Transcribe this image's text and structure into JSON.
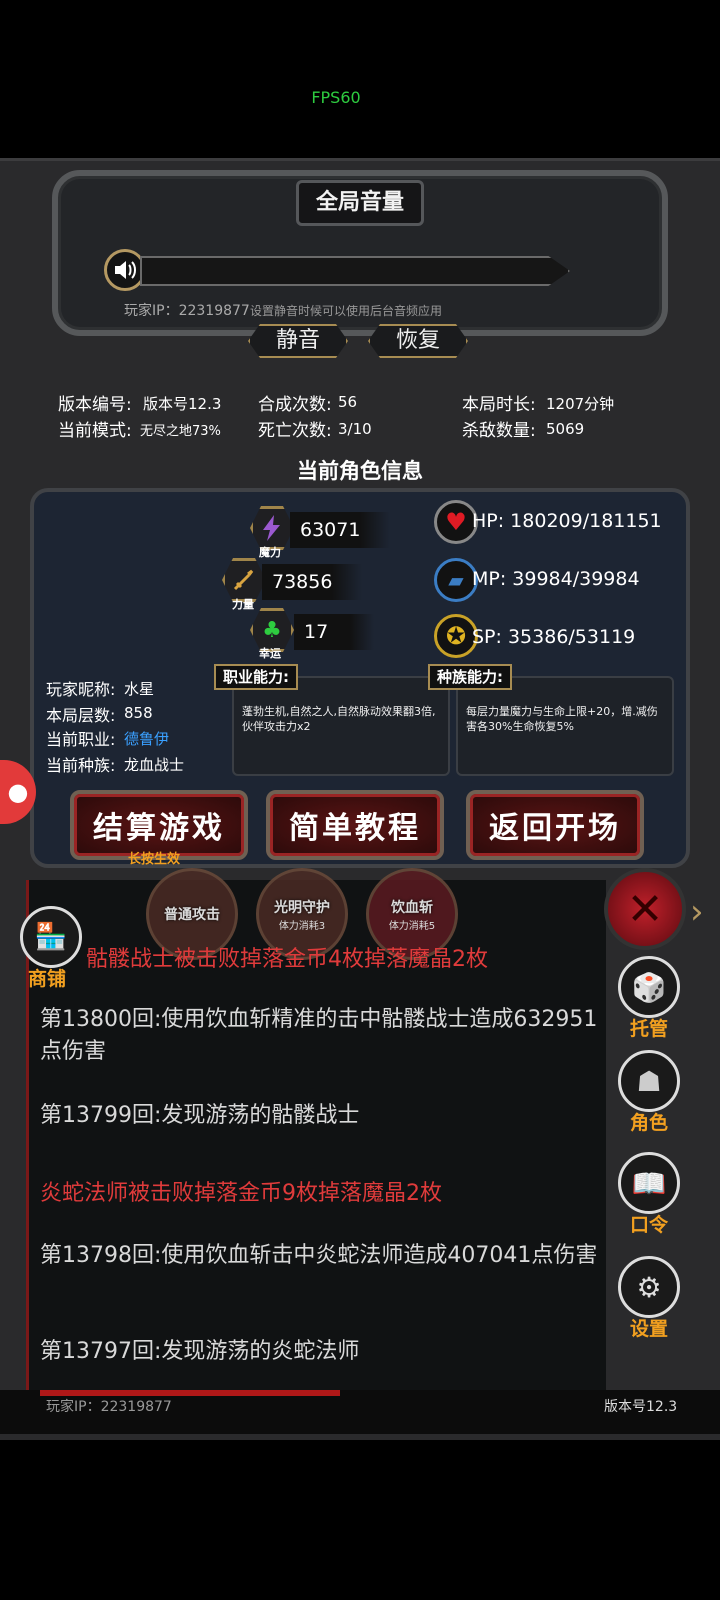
{
  "fps": "FPS60",
  "volume_panel": {
    "title": "全局音量",
    "player_ip": "玩家IP：22319877",
    "hint": "设置静音时候可以使用后台音频应用",
    "mute_label": "静音",
    "restore_label": "恢复"
  },
  "stats": {
    "version_label": "版本编号:",
    "version_value": "版本号12.3",
    "mode_label": "当前模式:",
    "mode_value": "无尽之地73%",
    "merge_label": "合成次数:",
    "merge_value": "56",
    "death_label": "死亡次数:",
    "death_value": "3/10",
    "time_label": "本局时长:",
    "time_value": "1207分钟",
    "kills_label": "杀敌数量:",
    "kills_value": "5069"
  },
  "character": {
    "title": "当前角色信息",
    "magic": {
      "value": "63071",
      "label": "魔力"
    },
    "strength": {
      "value": "73856",
      "label": "力量"
    },
    "luck": {
      "value": "17",
      "label": "幸运"
    },
    "hp": "HP:  180209/181151",
    "mp": "MP:  39984/39984",
    "sp": "SP:  35386/53119",
    "nickname_label": "玩家昵称:",
    "nickname": "水星",
    "floors_label": "本局层数:",
    "floors": "858",
    "class_label": "当前职业:",
    "class": "德鲁伊",
    "race_label": "当前种族:",
    "race": "龙血战士",
    "class_ability_tag": "职业能力:",
    "class_ability_text": "蓬勃生机,自然之人,自然脉动效果翻3倍,伙伴攻击力x2",
    "race_ability_tag": "种族能力:",
    "race_ability_text": "每层力量魔力与生命上限+20，增.减伤害各30%生命恢复5%"
  },
  "actions": {
    "settle": "结算游戏",
    "settle_sub": "长按生效",
    "tutorial": "简单教程",
    "back": "返回开场"
  },
  "skills": [
    {
      "name": "普通攻击",
      "cost": ""
    },
    {
      "name": "光明守护",
      "cost": "体力消耗3"
    },
    {
      "name": "饮血斩",
      "cost": "体力消耗5"
    }
  ],
  "shop_label": "商铺",
  "log": [
    {
      "text": "骷髅战士被击败掉落金币4枚掉落魔晶2枚",
      "type": "red"
    },
    {
      "text": "第13800回:使用饮血斩精准的击中骷髅战士造成632951点伤害",
      "type": "normal"
    },
    {
      "text": "第13799回:发现游荡的骷髅战士",
      "type": "normal"
    },
    {
      "text": "炎蛇法师被击败掉落金币9枚掉落魔晶2枚",
      "type": "red"
    },
    {
      "text": "第13798回:使用饮血斩击中炎蛇法师造成407041点伤害",
      "type": "normal"
    },
    {
      "text": "第13797回:发现游荡的炎蛇法师",
      "type": "normal"
    }
  ],
  "side_menu": {
    "auto": "托管",
    "role": "角色",
    "code": "口令",
    "settings": "设置"
  },
  "footer": {
    "ip": "玩家IP：22319877",
    "version": "版本号12.3"
  },
  "colors": {
    "accent": "#a78c52",
    "danger": "#e03b3b",
    "menu_label": "#f2a020",
    "class_link": "#3aa0ff"
  },
  "icons": [
    "speaker-icon",
    "magic-bolt-icon",
    "sword-icon",
    "clover-icon",
    "heart-icon",
    "mana-icon",
    "strength-icon",
    "dice-icon",
    "hood-icon",
    "book-icon",
    "gear-icon",
    "close-icon",
    "shop-icon",
    "user-icon"
  ]
}
